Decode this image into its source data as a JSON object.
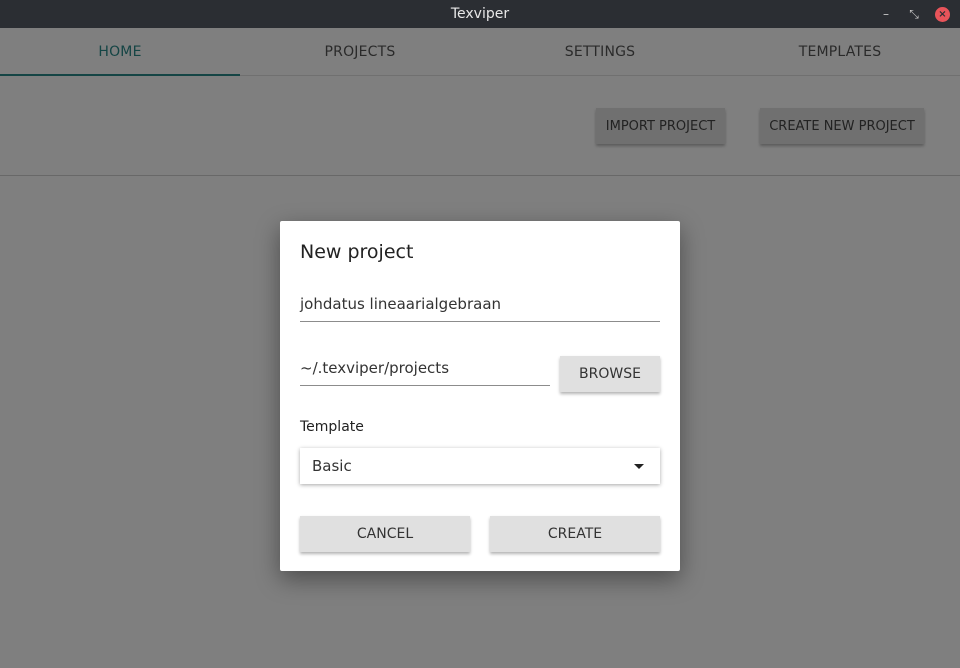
{
  "window": {
    "title": "Texviper",
    "minimize_glyph": "–",
    "restore_glyph": "⤡",
    "close_glyph": "×"
  },
  "tabs": [
    {
      "label": "HOME",
      "active": true
    },
    {
      "label": "PROJECTS",
      "active": false
    },
    {
      "label": "SETTINGS",
      "active": false
    },
    {
      "label": "TEMPLATES",
      "active": false
    }
  ],
  "actions": {
    "import_label": "IMPORT PROJECT",
    "create_new_label": "CREATE NEW PROJECT"
  },
  "dialog": {
    "title": "New project",
    "project_name": "johdatus lineaarialgebraan",
    "project_path": "~/.texviper/projects",
    "browse_label": "BROWSE",
    "template_label": "Template",
    "template_selected": "Basic",
    "cancel_label": "CANCEL",
    "create_label": "CREATE"
  },
  "colors": {
    "accent": "#2a8b8b",
    "titlebar": "#2b2e33",
    "close": "#e8545a"
  }
}
